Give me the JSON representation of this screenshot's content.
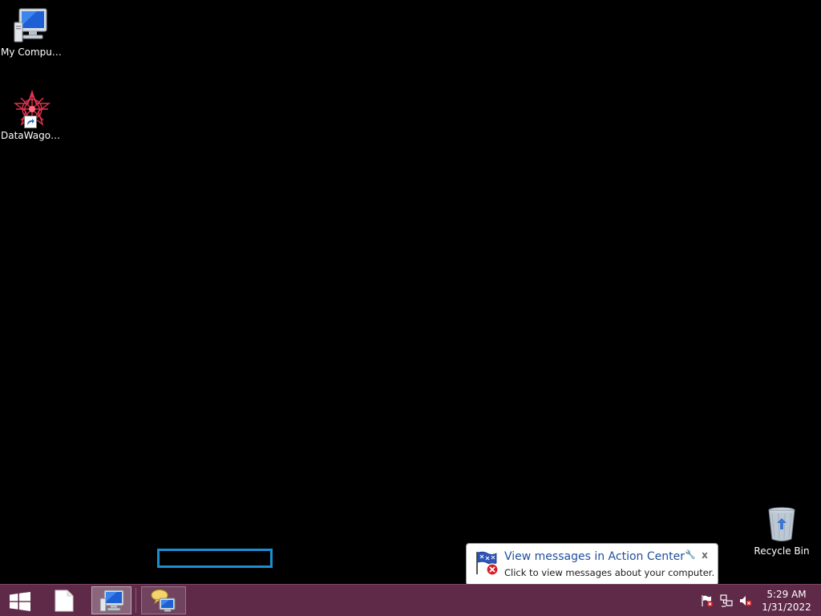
{
  "desktop": {
    "icons": [
      {
        "label": "My Computer",
        "icon": "computer-icon"
      },
      {
        "label": "DataWagon...",
        "icon": "datawagon-shortcut-icon"
      },
      {
        "label": "Recycle Bin",
        "icon": "recycle-bin-icon"
      }
    ]
  },
  "notification": {
    "title": "View messages in Action Center",
    "body": "Click to view messages about your computer.",
    "options_glyph": "🔧",
    "close_glyph": "x"
  },
  "taskbar": {
    "start_icon": "windows-logo-icon",
    "pinned": [
      {
        "icon": "file-icon"
      },
      {
        "icon": "computer-icon"
      },
      {
        "icon": "remote-desktop-icon"
      }
    ],
    "tray": [
      "action-center-flag-icon",
      "network-icon",
      "speaker-muted-icon"
    ],
    "clock": {
      "time": "5:29 AM",
      "date": "1/31/2022"
    }
  },
  "colors": {
    "desktop_bg": "#000000",
    "taskbar_bg": "#5e2a48",
    "selection_border": "#1a8fd1",
    "balloon_title": "#1f4f9c"
  }
}
